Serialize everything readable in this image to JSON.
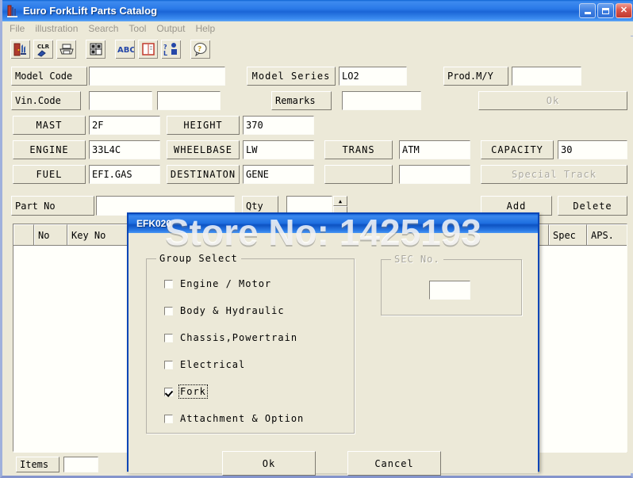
{
  "window": {
    "title": "Euro ForkLift Parts Catalog",
    "icon": "forklift-icon",
    "minimize": "_",
    "maximize": "□",
    "close": "✕"
  },
  "menu": {
    "items": [
      {
        "label": "File"
      },
      {
        "label": "illustration"
      },
      {
        "label": "Search"
      },
      {
        "label": "Tool"
      },
      {
        "label": "Output"
      },
      {
        "label": "Help"
      }
    ]
  },
  "toolbar": {
    "buttons": [
      {
        "name": "exit-door-icon",
        "glyph": "🚪"
      },
      {
        "name": "clear-eraser-icon",
        "glyph": "CLR"
      },
      {
        "name": "print-icon",
        "glyph": "🖨"
      },
      {
        "name": "grid-icon",
        "glyph": "▦"
      },
      {
        "name": "abc-icon",
        "glyph": "ABC"
      },
      {
        "name": "book-icon",
        "glyph": "📕"
      },
      {
        "name": "language-icon",
        "glyph": "?"
      },
      {
        "name": "help-icon",
        "glyph": "?"
      }
    ]
  },
  "form": {
    "model_code_label": "Model Code",
    "model_code_value": "",
    "model_series_label": "Model Series",
    "model_series_value": "LO2",
    "prod_my_label": "Prod.M/Y",
    "prod_my_value": "",
    "vin_code_label": "Vin.Code",
    "vin_code_value1": "",
    "vin_code_value2": "",
    "remarks_label": "Remarks",
    "remarks_value": "",
    "ok_label": "Ok",
    "mast_label": "MAST",
    "mast_value": "2F",
    "height_label": "HEIGHT",
    "height_value": "370",
    "engine_label": "ENGINE",
    "engine_value": "33L4C",
    "wheelbase_label": "WHEELBASE",
    "wheelbase_value": "LW",
    "trans_label": "TRANS",
    "trans_value": "ATM",
    "capacity_label": "CAPACITY",
    "capacity_value": "30",
    "fuel_label": "FUEL",
    "fuel_value": "EFI.GAS",
    "destination_label": "DESTINATON",
    "destination_value": "GENE",
    "blank_btn_label": "",
    "blank_value": "",
    "special_track_label": "Special Track"
  },
  "partbar": {
    "part_no_label": "Part No",
    "part_no_value": "",
    "qty_label": "Qty",
    "qty_value": "",
    "spinner_up": "▲",
    "add_label": "Add",
    "delete_label": "Delete"
  },
  "grid": {
    "columns": [
      "",
      "No",
      "Key No",
      "Spec",
      "APS."
    ],
    "rows": []
  },
  "footer": {
    "items_label": "Items",
    "items_value": ""
  },
  "dialog": {
    "title": "EFK020",
    "group_select_legend": "Group Select",
    "sec_no_legend": "SEC No.",
    "sec_no_value": "",
    "checkboxes": [
      {
        "label": "Engine / Motor",
        "checked": false,
        "focused": false
      },
      {
        "label": "Body & Hydraulic",
        "checked": false,
        "focused": false
      },
      {
        "label": "Chassis,Powertrain",
        "checked": false,
        "focused": false
      },
      {
        "label": "Electrical",
        "checked": false,
        "focused": false
      },
      {
        "label": "Fork",
        "checked": true,
        "focused": true
      },
      {
        "label": "Attachment & Option",
        "checked": false,
        "focused": false
      }
    ],
    "ok_label": "Ok",
    "cancel_label": "Cancel"
  },
  "watermark": {
    "text": "Store No: 1425193"
  },
  "colors": {
    "desktop": "#7e8fc4",
    "face": "#ece9d8",
    "title_blue": "#1b65d6",
    "dialog_border": "#0a46b6",
    "field_white": "#fffffa",
    "disabled_text": "#acaaa0"
  }
}
